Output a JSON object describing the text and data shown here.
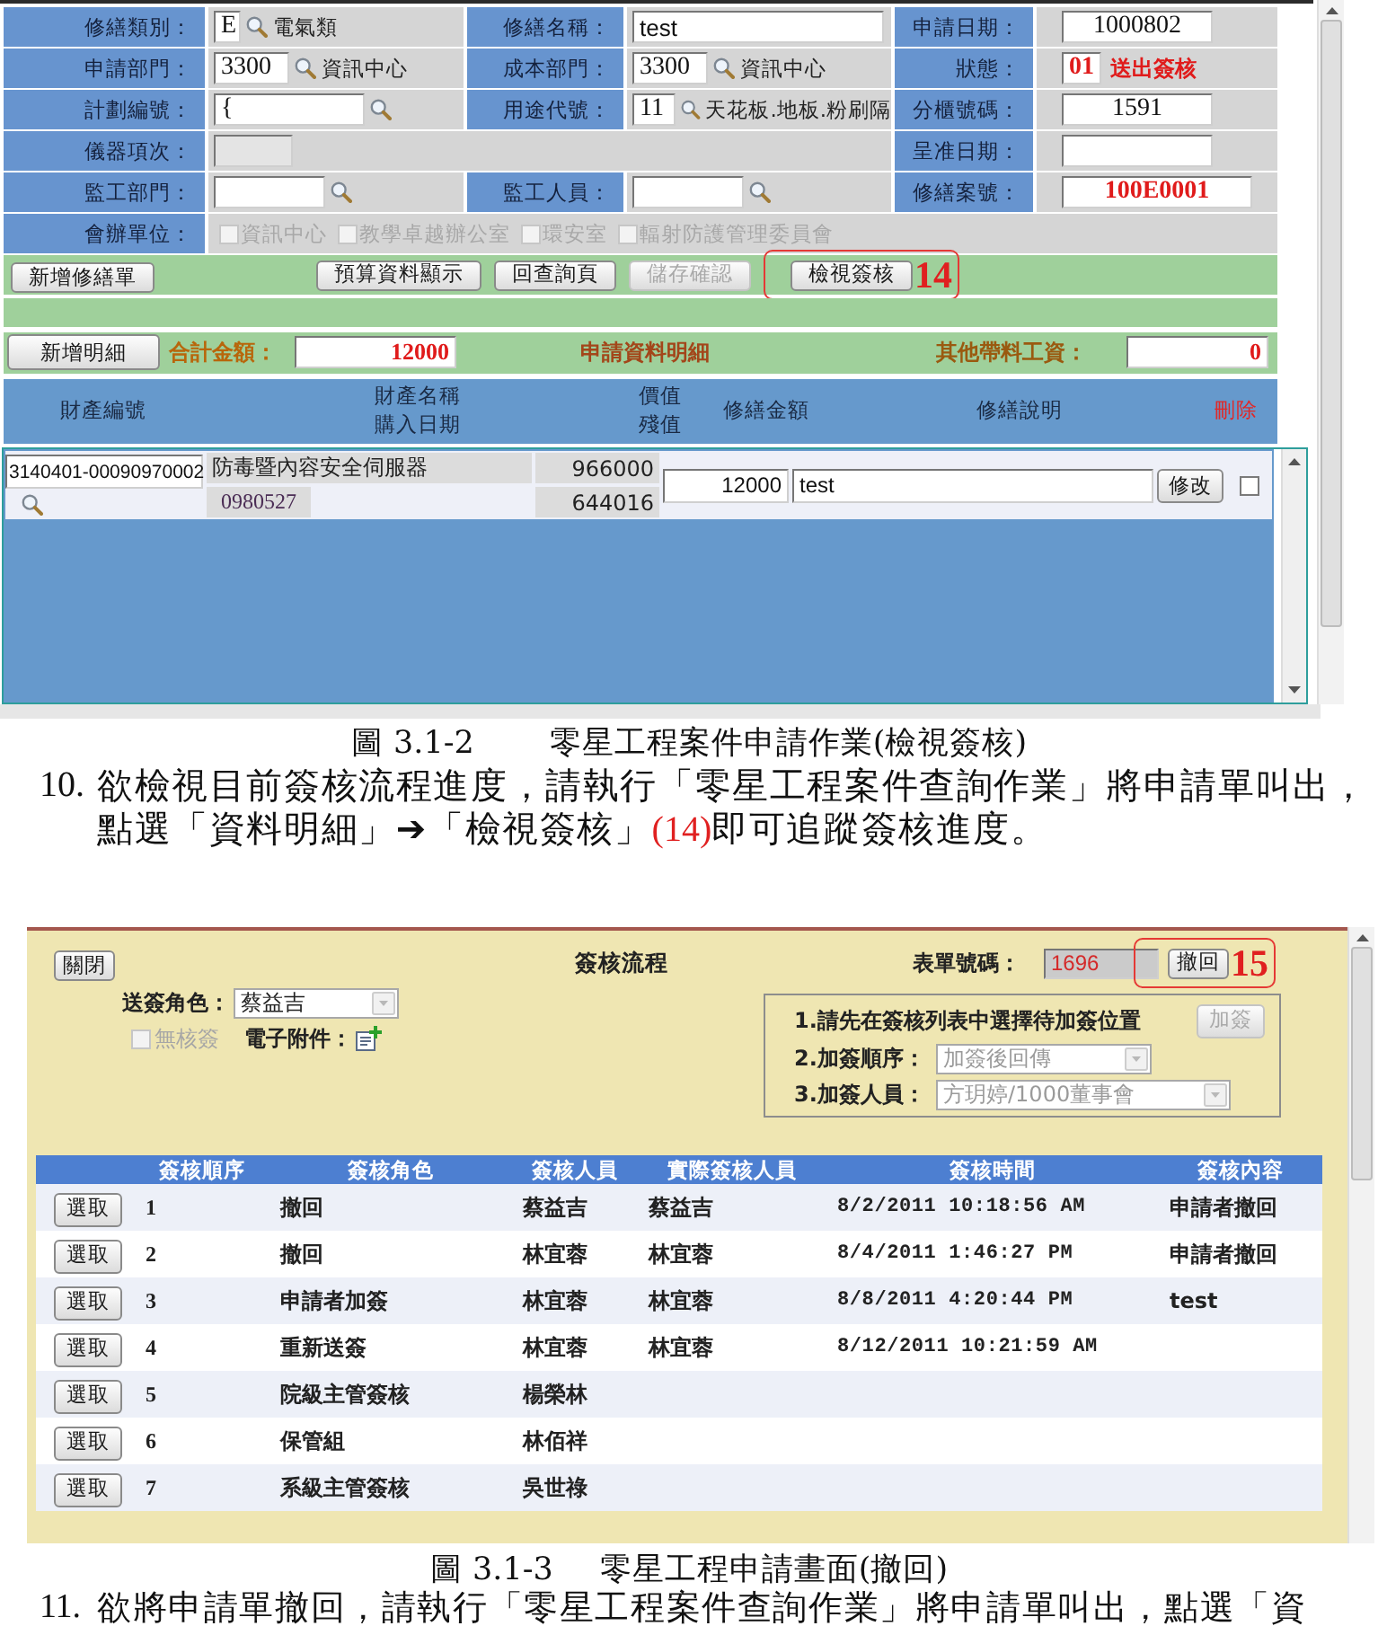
{
  "figure_1": {
    "form": {
      "rows": [
        {
          "fields": [
            {
              "label": "修繕類別：",
              "value": {
                "kind": "lookup",
                "code": "E",
                "name": "電氣類"
              }
            },
            {
              "label": "修繕名稱：",
              "value": {
                "kind": "text",
                "text": "test"
              }
            },
            {
              "label": "申請日期：",
              "value": {
                "kind": "field",
                "text": "1000802"
              }
            }
          ]
        },
        {
          "fields": [
            {
              "label": "申請部門：",
              "value": {
                "kind": "lookup",
                "code": "3300",
                "name": "資訊中心"
              }
            },
            {
              "label": "成本部門：",
              "value": {
                "kind": "lookup",
                "code": "3300",
                "name": "資訊中心"
              }
            },
            {
              "label": "狀態：",
              "value": {
                "kind": "status",
                "code": "01",
                "name": "送出簽核"
              }
            }
          ]
        },
        {
          "fields": [
            {
              "label": "計劃編號：",
              "value": {
                "kind": "lookup",
                "code": "{"
              }
            },
            {
              "label": "用途代號：",
              "value": {
                "kind": "lookup",
                "code": "11",
                "name": "天花板.地板.粉刷隔"
              }
            },
            {
              "label": "分櫃號碼：",
              "value": {
                "kind": "field",
                "text": "1591"
              }
            }
          ]
        },
        {
          "fields": [
            {
              "label": "儀器項次：",
              "value": {
                "kind": "disabled"
              }
            },
            {
              "label": "呈准日期：",
              "value": {
                "kind": "field"
              }
            }
          ]
        },
        {
          "fields": [
            {
              "label": "監工部門：",
              "value": {
                "kind": "lookup"
              }
            },
            {
              "label": "監工人員：",
              "value": {
                "kind": "lookup"
              }
            },
            {
              "label": "修繕案號：",
              "value": {
                "kind": "highlight",
                "text": "100E0001"
              }
            }
          ]
        },
        {
          "fields": [
            {
              "label": "會辦單位：",
              "value": {
                "kind": "checkboxes",
                "options": [
                  {
                    "label": "資訊中心",
                    "checked": false,
                    "disabled": true
                  },
                  {
                    "label": "教學卓越辦公室",
                    "checked": false,
                    "disabled": true
                  },
                  {
                    "label": "環安室",
                    "checked": false,
                    "disabled": true
                  },
                  {
                    "label": "輻射防護管理委員會",
                    "checked": false,
                    "disabled": true
                  }
                ]
              }
            }
          ]
        }
      ]
    },
    "toolbar": {
      "buttons": [
        {
          "label": "新增修繕單",
          "disabled": false
        },
        {
          "label": "預算資料顯示",
          "disabled": false
        },
        {
          "label": "回查詢頁",
          "disabled": false
        },
        {
          "label": "儲存確認",
          "disabled": true
        },
        {
          "label": "檢視簽核",
          "disabled": false,
          "callout": "14"
        }
      ]
    },
    "detail_bar": {
      "add_button": "新增明細",
      "total_label": "合計金額：",
      "total": "12000",
      "title": "申請資料明細",
      "other_label": "其他帶料工資：",
      "other": "0"
    },
    "detail_table": {
      "columns": [
        {
          "lines": [
            "財產編號"
          ],
          "kind": "plain"
        },
        {
          "lines": [
            "財產名稱",
            "購入日期"
          ],
          "kind": "plain"
        },
        {
          "lines": [
            "價值",
            "殘值"
          ],
          "kind": "plain"
        },
        {
          "lines": [
            "修繕金額"
          ],
          "kind": "plain"
        },
        {
          "lines": [
            "修繕說明"
          ],
          "kind": "plain"
        },
        {
          "lines": [
            "刪除"
          ],
          "kind": "danger"
        }
      ],
      "rows": [
        {
          "asset_no": "3140401-00090970002",
          "asset_name": "防毒暨內容安全伺服器",
          "purchase_date": "0980527",
          "value": "966000",
          "residual": "644016",
          "amount": "12000",
          "note": "test",
          "edit_button": "修改",
          "checked": false
        }
      ]
    }
  },
  "caption_1": {
    "number": "圖 3.1-2",
    "title": "零星工程案件申請作業(檢視簽核)"
  },
  "step_10": {
    "number": "10.",
    "parts": [
      {
        "kind": "plain",
        "text": "欲檢視目前簽核流程進度，請執行「零星工程案件查詢作業」將申請單叫出，點選「資料明細」"
      },
      {
        "kind": "arrow",
        "text": "➔"
      },
      {
        "kind": "plain",
        "text": "「檢視簽核」"
      },
      {
        "kind": "ref",
        "text": "(14)"
      },
      {
        "kind": "plain",
        "text": "即可追蹤簽核進度。"
      }
    ]
  },
  "figure_2": {
    "close_button": "關閉",
    "title": "簽核流程",
    "form_no_label": "表單號碼：",
    "form_no": "1696",
    "withdraw_button": "撤回",
    "callout": "15",
    "sender_role_label": "送簽角色：",
    "sender_role": {
      "value": "蔡益吉",
      "disabled": false
    },
    "no_sign": {
      "label": "無核簽",
      "checked": false,
      "disabled": true
    },
    "attachment_label": "電子附件：",
    "add_sign": {
      "instruction": "1.請先在簽核列表中選擇待加簽位置",
      "button": {
        "label": "加簽",
        "disabled": true
      },
      "order_label": "2.加簽順序：",
      "order": {
        "value": "加簽後回傳",
        "disabled": true
      },
      "person_label": "3.加簽人員：",
      "person": {
        "value": "方玥婷/1000董事會",
        "disabled": true
      }
    },
    "table": {
      "columns": [
        "簽核順序",
        "簽核角色",
        "簽核人員",
        "實際簽核人員",
        "簽核時間",
        "簽核內容"
      ],
      "rows": [
        {
          "button": "選取",
          "cells": [
            "1",
            "撤回",
            "蔡益吉",
            "蔡益吉",
            "8/2/2011 10:18:56 AM",
            "申請者撤回"
          ]
        },
        {
          "button": "選取",
          "cells": [
            "2",
            "撤回",
            "林宜蓉",
            "林宜蓉",
            "8/4/2011 1:46:27 PM",
            "申請者撤回"
          ]
        },
        {
          "button": "選取",
          "cells": [
            "3",
            "申請者加簽",
            "林宜蓉",
            "林宜蓉",
            "8/8/2011 4:20:44 PM",
            "test"
          ]
        },
        {
          "button": "選取",
          "cells": [
            "4",
            "重新送簽",
            "林宜蓉",
            "林宜蓉",
            "8/12/2011 10:21:59 AM"
          ]
        },
        {
          "button": "選取",
          "cells": [
            "5",
            "院級主管簽核",
            "楊榮林"
          ]
        },
        {
          "button": "選取",
          "cells": [
            "6",
            "保管組",
            "林佰祥"
          ]
        },
        {
          "button": "選取",
          "cells": [
            "7",
            "系級主管簽核",
            "吳世祿"
          ]
        }
      ]
    }
  },
  "caption_2": {
    "number": "圖 3.1-3",
    "title": "零星工程申請畫面(撤回)"
  },
  "step_11": {
    "number": "11.",
    "text": "欲將申請單撤回，請執行「零星工程案件查詢作業」將申請單叫出，點選「資"
  }
}
